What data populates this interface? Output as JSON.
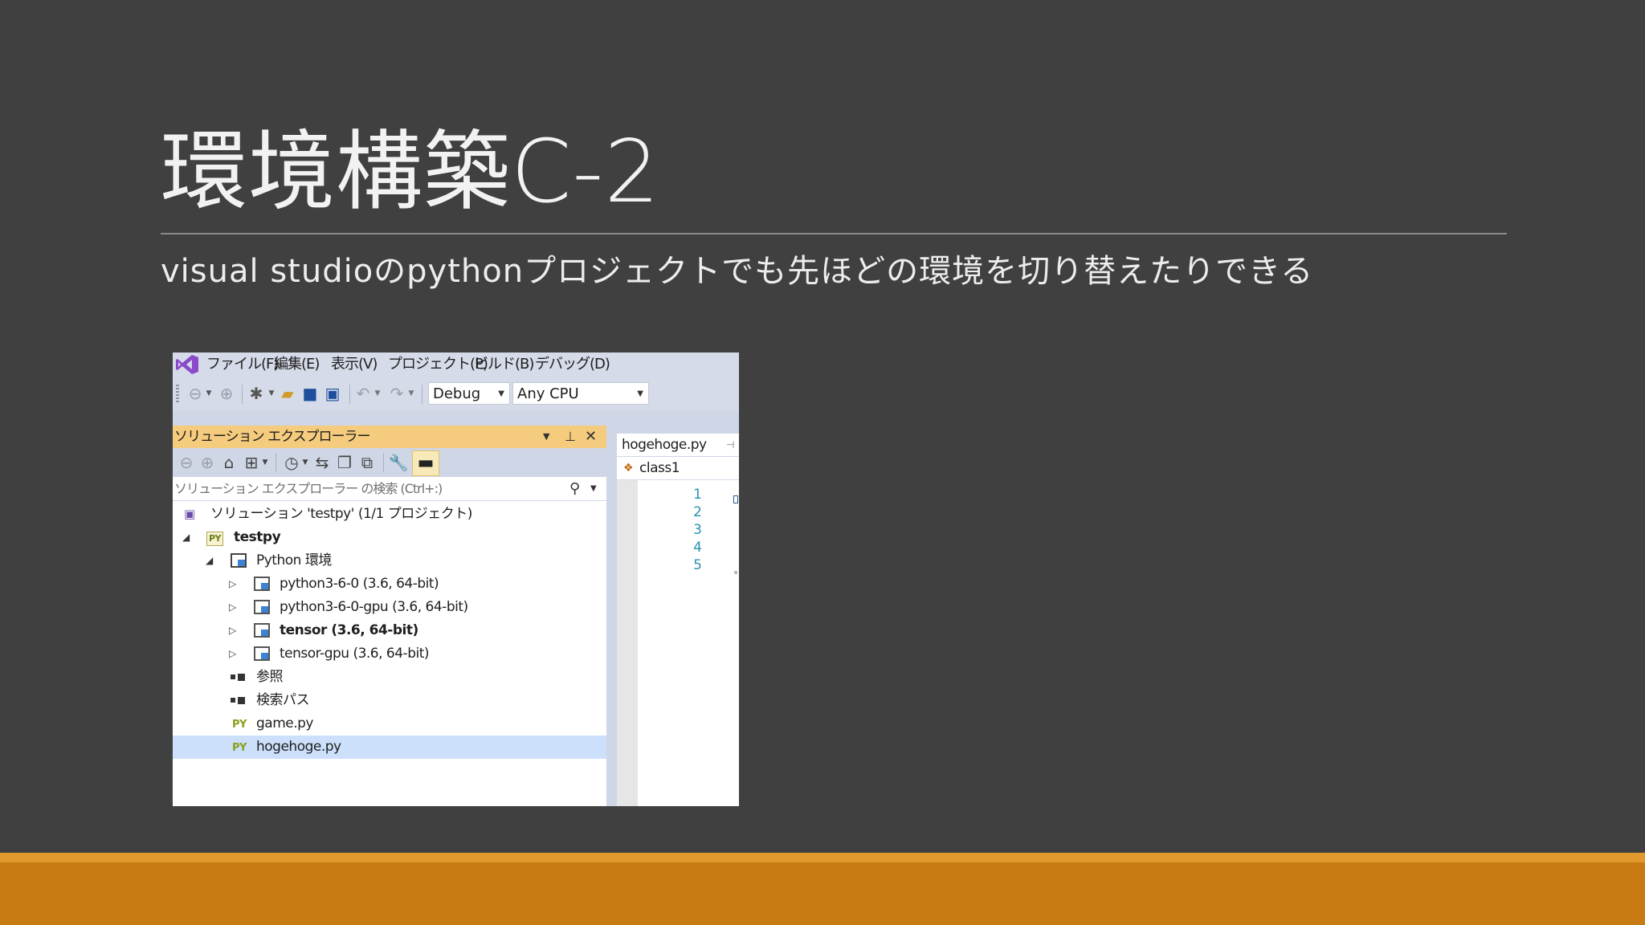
{
  "slide": {
    "title": "環境構築C-2",
    "subtitle": "visual studioのpythonプロジェクトでも先ほどの環境を切り替えたりできる"
  },
  "colors": {
    "background": "#404040",
    "accent_bar": "#c77b12",
    "panel_title": "#f5cb7d",
    "selection": "#cce0fb"
  },
  "vs": {
    "menu": [
      "ファイル(F)",
      "編集(E)",
      "表示(V)",
      "プロジェクト(P)",
      "ビルド(B)",
      "デバッグ(D)"
    ],
    "toolbar": {
      "config": "Debug",
      "platform": "Any CPU",
      "icons": [
        "back-icon",
        "forward-icon",
        "new-project-icon",
        "open-icon",
        "save-icon",
        "save-all-icon",
        "undo-icon",
        "redo-icon"
      ]
    },
    "solution_explorer": {
      "title": "ソリューション エクスプローラー",
      "search_placeholder": "ソリューション エクスプローラー の検索 (Ctrl+:)",
      "tree": [
        {
          "label": "ソリューション 'testpy' (1/1 プロジェクト)",
          "icon": "solution-icon"
        },
        {
          "label": "testpy",
          "icon": "python-project-icon",
          "badge": "PY"
        },
        {
          "label": "Python 環境",
          "icon": "python-environments-icon"
        },
        {
          "label": "python3-6-0 (3.6, 64-bit)",
          "icon": "environment-icon"
        },
        {
          "label": "python3-6-0-gpu (3.6, 64-bit)",
          "icon": "environment-icon"
        },
        {
          "label": "tensor (3.6, 64-bit)",
          "icon": "environment-icon"
        },
        {
          "label": "tensor-gpu (3.6, 64-bit)",
          "icon": "environment-icon"
        },
        {
          "label": "参照",
          "icon": "references-icon"
        },
        {
          "label": "検索パス",
          "icon": "search-paths-icon"
        },
        {
          "label": "game.py",
          "icon": "python-file-icon",
          "badge": "PY"
        },
        {
          "label": "hogehoge.py",
          "icon": "python-file-icon",
          "badge": "PY"
        }
      ]
    },
    "editor": {
      "tab": "hogehoge.py",
      "nav": "class1",
      "line_numbers": [
        "1",
        "2",
        "3",
        "4",
        "5"
      ]
    }
  }
}
